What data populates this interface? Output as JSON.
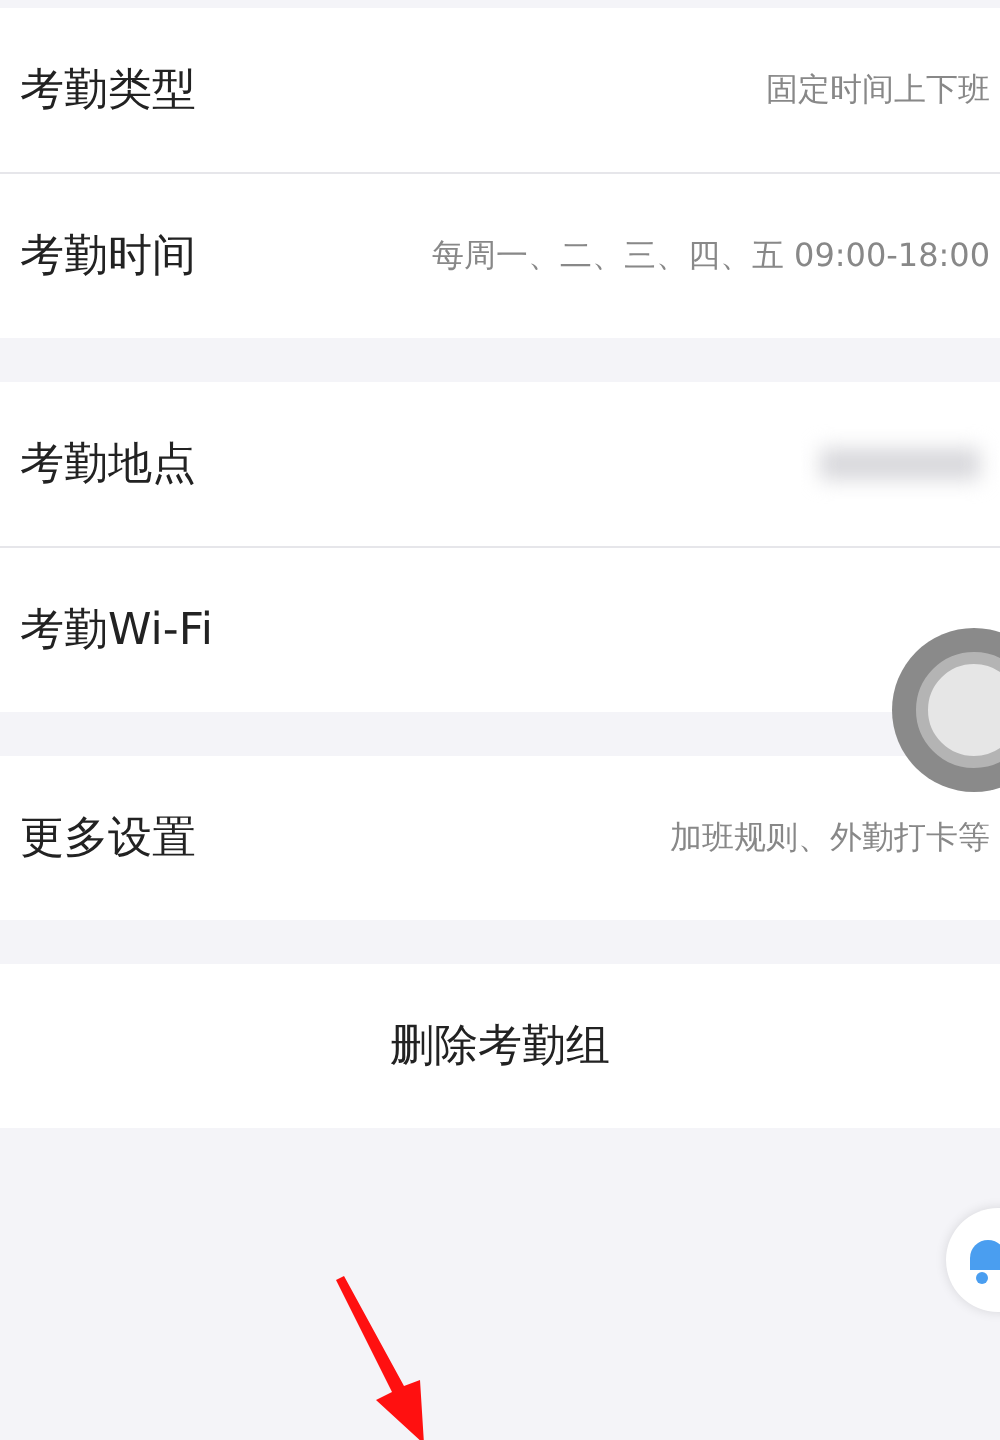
{
  "groups": [
    {
      "rows": [
        {
          "label": "考勤类型",
          "value": "固定时间上下班"
        },
        {
          "label": "考勤时间",
          "value": "每周一、二、三、四、五 09:00-18:00"
        }
      ]
    },
    {
      "rows": [
        {
          "label": "考勤地点",
          "blurred": true
        },
        {
          "label": "考勤Wi-Fi"
        }
      ]
    },
    {
      "rows": [
        {
          "label": "更多设置",
          "value": "加班规则、外勤打卡等"
        }
      ]
    }
  ],
  "delete_button": "删除考勤组"
}
